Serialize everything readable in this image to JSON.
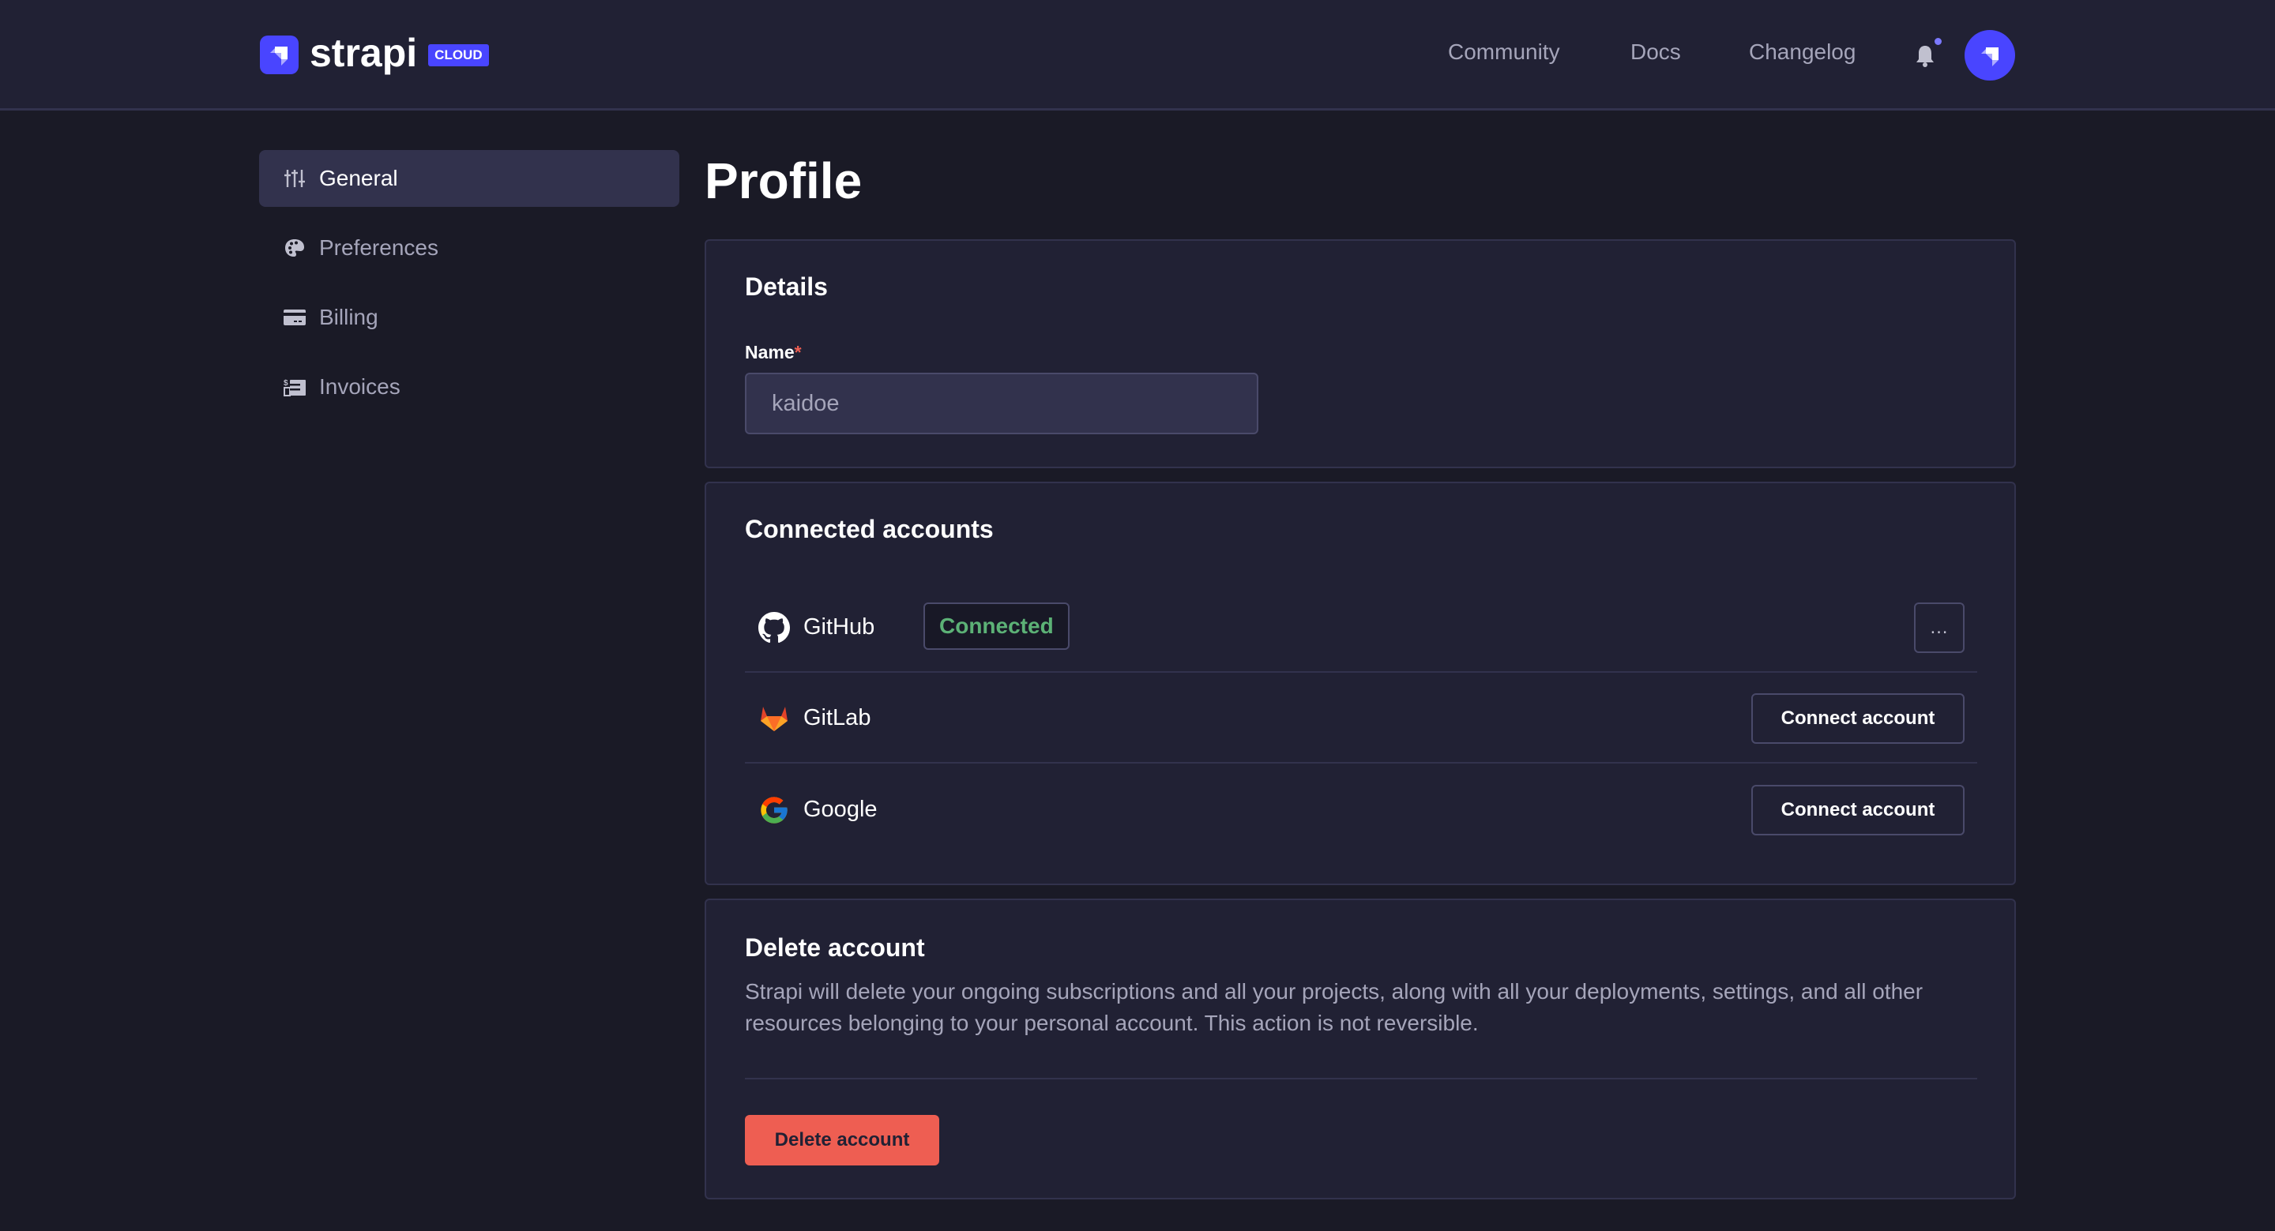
{
  "header": {
    "brand": "strapi",
    "badge": "CLOUD",
    "nav": [
      {
        "label": "Community"
      },
      {
        "label": "Docs"
      },
      {
        "label": "Changelog"
      }
    ],
    "notification_icon": "bell-icon",
    "has_unread_notifications": true
  },
  "sidebar": {
    "items": [
      {
        "label": "General",
        "icon": "sliders-icon",
        "active": true
      },
      {
        "label": "Preferences",
        "icon": "palette-icon",
        "active": false
      },
      {
        "label": "Billing",
        "icon": "credit-card-icon",
        "active": false
      },
      {
        "label": "Invoices",
        "icon": "invoice-icon",
        "active": false
      }
    ]
  },
  "page": {
    "title": "Profile"
  },
  "details": {
    "title": "Details",
    "name_label": "Name",
    "required_marker": "*",
    "name_value": "kaidoe"
  },
  "connected_accounts": {
    "title": "Connected accounts",
    "accounts": [
      {
        "name": "GitHub",
        "icon": "github-icon",
        "status": "Connected",
        "action": "…"
      },
      {
        "name": "GitLab",
        "icon": "gitlab-icon",
        "action": "Connect account"
      },
      {
        "name": "Google",
        "icon": "google-icon",
        "action": "Connect account"
      }
    ]
  },
  "delete_account": {
    "title": "Delete account",
    "description": "Strapi will delete your ongoing subscriptions and all your projects, along with all your deployments, settings, and all other resources belonging to your personal account. This action is not reversible.",
    "button_label": "Delete account"
  },
  "colors": {
    "accent": "#4945ff",
    "success": "#5cb176",
    "danger": "#ee5e52",
    "background": "#1a1a26",
    "surface": "#212134"
  }
}
